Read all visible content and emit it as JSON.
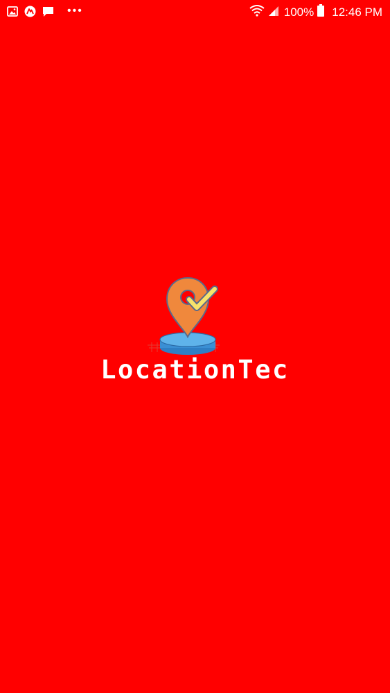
{
  "status_bar": {
    "battery_percent": "100%",
    "time": "12:46 PM",
    "notification_icons": [
      "gallery-icon",
      "app-notification-icon",
      "message-icon",
      "more-dots-icon"
    ],
    "system_icons": [
      "wifi-icon",
      "signal-icon",
      "battery-icon"
    ]
  },
  "splash": {
    "app_name": "LocationTec",
    "logo_icon": "location-pin-check-icon"
  },
  "colors": {
    "background": "#ff0000",
    "text": "#ffffff",
    "pin": "#f0883c",
    "check": "#f7e36b",
    "platform": "#3a8fd4"
  }
}
